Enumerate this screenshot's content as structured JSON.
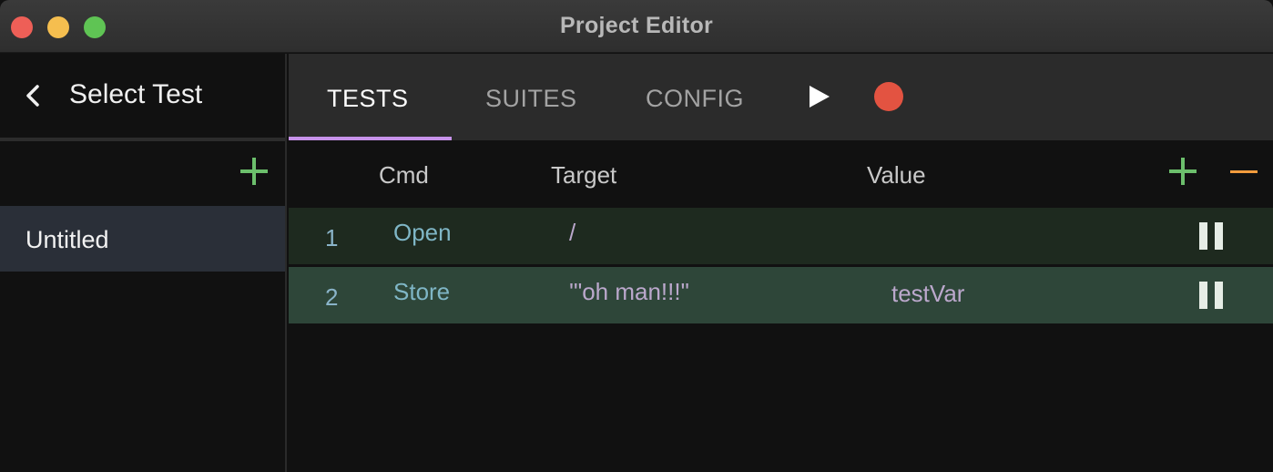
{
  "window": {
    "title": "Project Editor",
    "controls": [
      "close-icon",
      "minimize-icon",
      "maximize-icon"
    ]
  },
  "sidebar": {
    "back_icon": "chevron-left-icon",
    "title": "Select Test",
    "add_icon": "plus-icon",
    "tests": [
      {
        "label": "Untitled",
        "selected": true
      }
    ]
  },
  "tabs": [
    {
      "label": "TESTS",
      "active": true
    },
    {
      "label": "SUITES",
      "active": false
    },
    {
      "label": "CONFIG",
      "active": false
    }
  ],
  "toolbar": {
    "play_icon": "play-icon",
    "record_icon": "record-icon"
  },
  "table": {
    "columns": [
      "Cmd",
      "Target",
      "Value"
    ],
    "add_icon": "plus-icon",
    "remove_icon": "minus-icon",
    "rows": [
      {
        "index": "1",
        "cmd": "Open",
        "target": "/",
        "value": ""
      },
      {
        "index": "2",
        "cmd": "Store",
        "target": "'\"oh man!!!\"",
        "value": "testVar"
      }
    ]
  },
  "colors": {
    "accent_tab": "#c792ea",
    "add": "#6cbf6c",
    "remove": "#f39c3d",
    "record": "#e35341",
    "row_current": "#1e2a1f",
    "row_selected": "#2e4639"
  }
}
